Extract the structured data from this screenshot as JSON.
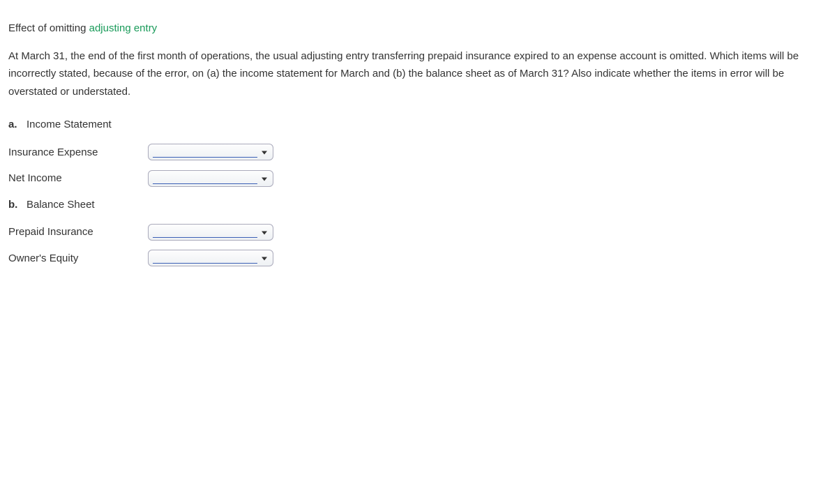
{
  "title": {
    "prefix": "Effect of omitting ",
    "link": "adjusting entry"
  },
  "question": "At March 31, the end of the first month of operations, the usual adjusting entry transferring prepaid insurance expired to an expense account is omitted. Which items will be incorrectly stated, because of the error, on (a) the income statement for March and (b) the balance sheet as of March 31? Also indicate whether the items in error will be overstated or understated.",
  "section_a": {
    "letter": "a.",
    "label": "Income Statement",
    "rows": [
      {
        "label": "Insurance Expense",
        "value": ""
      },
      {
        "label": "Net Income",
        "value": ""
      }
    ]
  },
  "section_b": {
    "letter": "b.",
    "label": "Balance Sheet",
    "rows": [
      {
        "label": "Prepaid Insurance",
        "value": ""
      },
      {
        "label": "Owner's Equity",
        "value": ""
      }
    ]
  }
}
